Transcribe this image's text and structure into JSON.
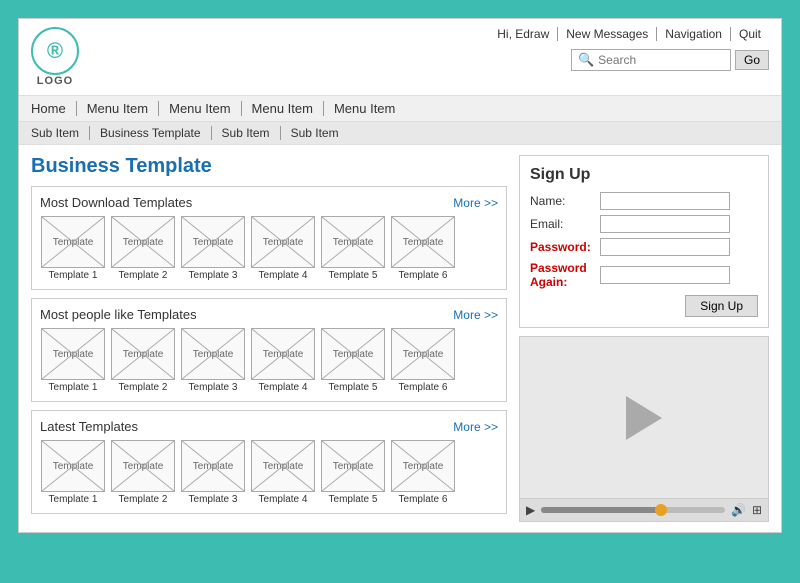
{
  "header": {
    "logo_text": "LOGO",
    "logo_symbol": "®",
    "top_nav": [
      "Hi, Edraw",
      "New Messages",
      "Navigation",
      "Quit"
    ],
    "search_placeholder": "Search",
    "go_label": "Go"
  },
  "nav": {
    "items": [
      "Home",
      "Menu Item",
      "Menu Item",
      "Menu Item",
      "Menu Item"
    ]
  },
  "sub_nav": {
    "items": [
      "Sub Item",
      "Business Template",
      "Sub Item",
      "Sub Item"
    ]
  },
  "page": {
    "title": "Business Template"
  },
  "sections": [
    {
      "title": "Most Download Templates",
      "more_label": "More >>",
      "templates": [
        {
          "label": "Template 1",
          "text": "Template"
        },
        {
          "label": "Template 2",
          "text": "Template"
        },
        {
          "label": "Template 3",
          "text": "Template"
        },
        {
          "label": "Template 4",
          "text": "Template"
        },
        {
          "label": "Template 5",
          "text": "Template"
        },
        {
          "label": "Template 6",
          "text": "Template"
        }
      ]
    },
    {
      "title": "Most people like Templates",
      "more_label": "More >>",
      "templates": [
        {
          "label": "Template 1",
          "text": "Template"
        },
        {
          "label": "Template 2",
          "text": "Template"
        },
        {
          "label": "Template 3",
          "text": "Template"
        },
        {
          "label": "Template 4",
          "text": "Template"
        },
        {
          "label": "Template 5",
          "text": "Template"
        },
        {
          "label": "Template 6",
          "text": "Template"
        }
      ]
    },
    {
      "title": "Latest Templates",
      "more_label": "More >>",
      "templates": [
        {
          "label": "Template 1",
          "text": "Template"
        },
        {
          "label": "Template 2",
          "text": "Template"
        },
        {
          "label": "Template 3",
          "text": "Template"
        },
        {
          "label": "Template 4",
          "text": "Template"
        },
        {
          "label": "Template 5",
          "text": "Template"
        },
        {
          "label": "Template 6",
          "text": "Template"
        }
      ]
    }
  ],
  "signup": {
    "title": "Sign Up",
    "fields": [
      {
        "label": "Name:",
        "red": false
      },
      {
        "label": "Email:",
        "red": false
      },
      {
        "label": "Password:",
        "red": true
      },
      {
        "label": "Password Again:",
        "red": true
      }
    ],
    "button_label": "Sign Up"
  },
  "video": {
    "progress_percent": 65
  }
}
